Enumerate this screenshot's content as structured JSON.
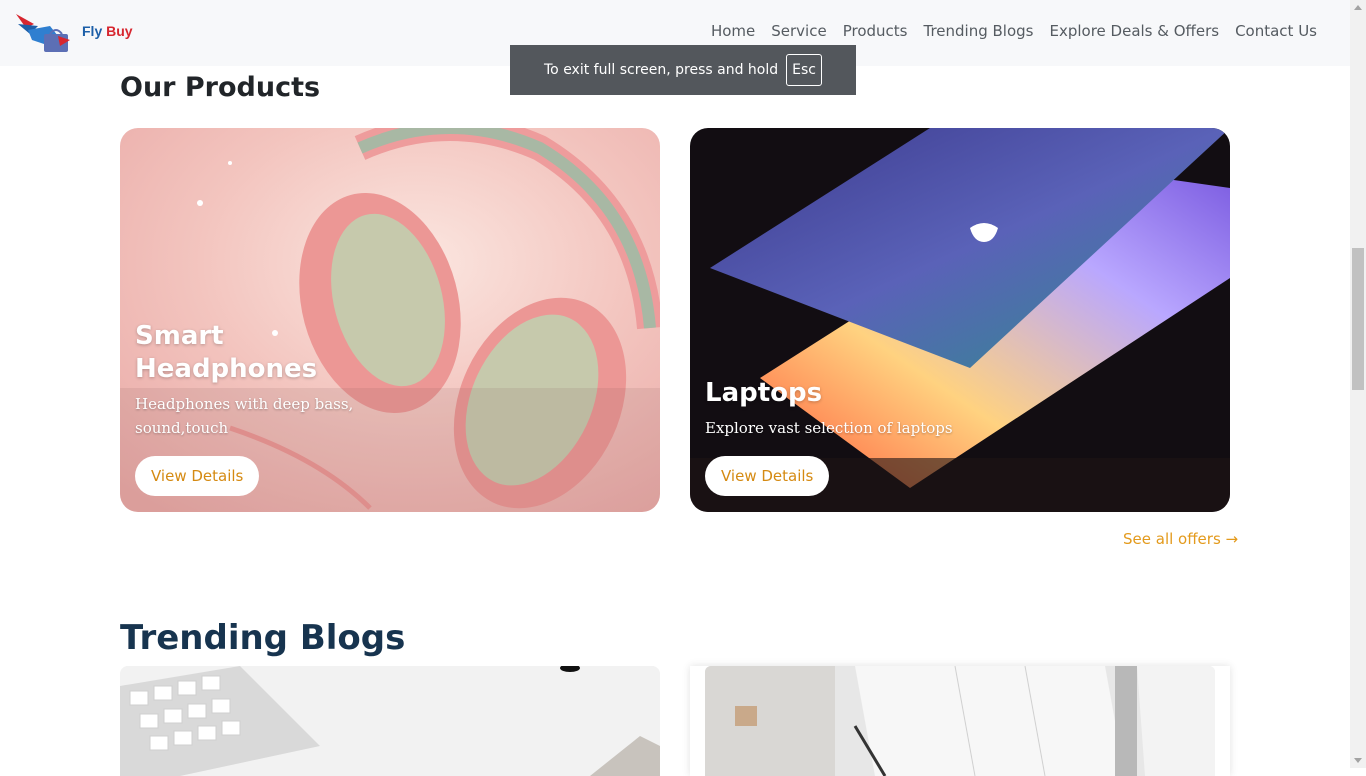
{
  "brand": {
    "name_part1": "Fly",
    "name_part2": "Buy"
  },
  "nav": {
    "items": [
      "Home",
      "Service",
      "Products",
      "Trending Blogs",
      "Explore Deals & Offers",
      "Contact Us"
    ]
  },
  "fullscreen_notice": {
    "text": "To exit full screen, press and hold",
    "key": "Esc"
  },
  "products": {
    "title": "Our Products",
    "cards": [
      {
        "title": "Smart Headphones",
        "text": "Headphones with deep bass, sound,touch",
        "button": "View Details"
      },
      {
        "title": "Laptops",
        "text": "Explore vast selection of laptops",
        "button": "View Details"
      }
    ],
    "see_all": "See all offers →"
  },
  "blogs": {
    "title": "Trending Blogs"
  },
  "colors": {
    "accent": "#e39a1c",
    "blog_title": "#17344f",
    "toast_bg": "#53575c"
  }
}
